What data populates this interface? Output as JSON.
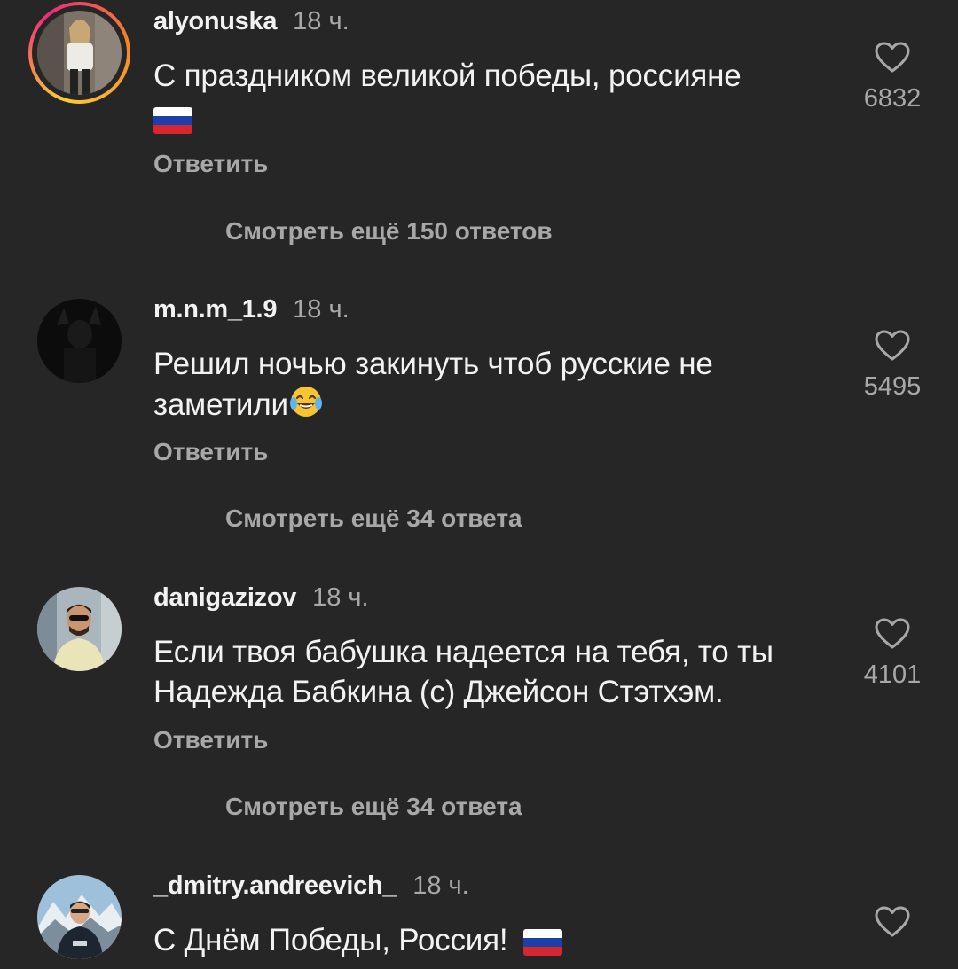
{
  "colors": {
    "background": "#262626",
    "text_primary": "#f2f2f2",
    "text_secondary": "#a8a8a8",
    "story_ring": "#ee2a7b"
  },
  "comments": [
    {
      "username": "alyonuska",
      "time": "18 ч.",
      "text": "С праздником великой победы, россияне",
      "emoji": "russia-flag",
      "likes": "6832",
      "reply": "Ответить",
      "more_replies": "Смотреть ещё 150 ответов"
    },
    {
      "username": "m.n.m_1.9",
      "time": "18 ч.",
      "text": "Решил ночью закинуть чтоб русские не заметили",
      "emoji": "laughing-tears",
      "likes": "5495",
      "reply": "Ответить",
      "more_replies": "Смотреть ещё 34 ответа"
    },
    {
      "username": "danigazizov",
      "time": "18 ч.",
      "text": "Если твоя бабушка надеется на тебя, то ты Надежда Бабкина (с) Джейсон Стэтхэм.",
      "likes": "4101",
      "reply": "Ответить",
      "more_replies": "Смотреть ещё 34 ответа"
    },
    {
      "username": "_dmitry.andreevich_",
      "time": "18 ч.",
      "text": "С Днём Победы, Россия!",
      "emoji": "russia-flag"
    }
  ]
}
